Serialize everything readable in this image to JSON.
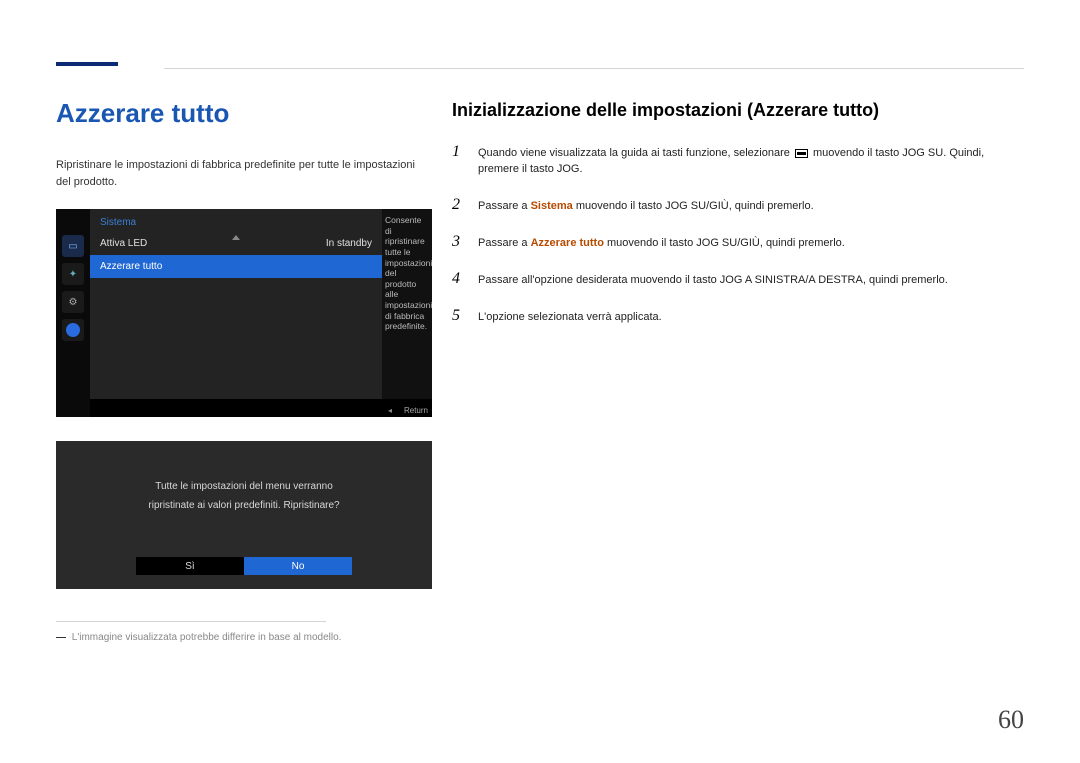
{
  "header": {
    "accent": "#0d2a74"
  },
  "left": {
    "title": "Azzerare tutto",
    "intro": "Ripristinare le impostazioni di fabbrica predefinite per tutte le impostazioni del prodotto.",
    "menu": {
      "category": "Sistema",
      "row1_label": "Attiva LED",
      "row1_value": "In standby",
      "row2_label": "Azzerare tutto",
      "hint": "Consente di ripristinare tutte le impostazioni del prodotto alle impostazioni di fabbrica predefinite.",
      "returnLabel": "Return"
    },
    "dialog": {
      "line1": "Tutte le impostazioni del menu verranno",
      "line2": "ripristinate ai valori predefiniti. Ripristinare?",
      "yes": "Sì",
      "no": "No"
    },
    "footnote": "L'immagine visualizzata potrebbe differire in base al modello."
  },
  "right": {
    "title": "Inizializzazione delle impostazioni (Azzerare tutto)",
    "steps": [
      {
        "num": "1",
        "pre": "Quando viene visualizzata la guida ai tasti funzione, selezionare ",
        "post": " muovendo il tasto JOG SU. Quindi, premere il tasto JOG."
      },
      {
        "num": "2",
        "pre": "Passare a ",
        "em": "Sistema",
        "post": " muovendo il tasto JOG SU/GIÙ, quindi premerlo."
      },
      {
        "num": "3",
        "pre": "Passare a ",
        "em": "Azzerare tutto",
        "post": " muovendo il tasto JOG SU/GIÙ, quindi premerlo."
      },
      {
        "num": "4",
        "text": "Passare all'opzione desiderata muovendo il tasto JOG A SINISTRA/A DESTRA, quindi premerlo."
      },
      {
        "num": "5",
        "text": "L'opzione selezionata verrà applicata."
      }
    ]
  },
  "page": "60"
}
